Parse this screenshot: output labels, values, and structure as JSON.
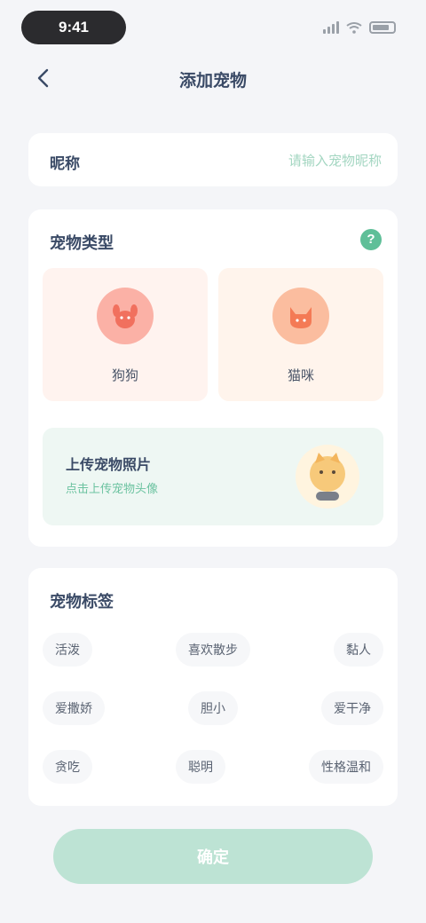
{
  "status_bar": {
    "time": "9:41"
  },
  "nav": {
    "title": "添加宠物"
  },
  "name_card": {
    "label": "昵称",
    "placeholder": "请输入宠物昵称"
  },
  "main_card": {
    "title": "宠物类型",
    "help_icon": "?",
    "types": [
      {
        "label": "狗狗"
      },
      {
        "label": "猫咪"
      }
    ],
    "upload": {
      "title": "上传宠物照片",
      "subtitle": "点击上传宠物头像"
    }
  },
  "tags_card": {
    "title": "宠物标签",
    "rows": [
      [
        "活泼",
        "喜欢散步",
        "黏人"
      ],
      [
        "爱撒娇",
        "胆小",
        "爱干净"
      ],
      [
        "贪吃",
        "聪明",
        "性格温和"
      ]
    ]
  },
  "confirm_button": {
    "label": "确定"
  },
  "colors": {
    "accent": "#5fbf98",
    "button": "#bde3d4",
    "background": "#f4f5f8"
  }
}
